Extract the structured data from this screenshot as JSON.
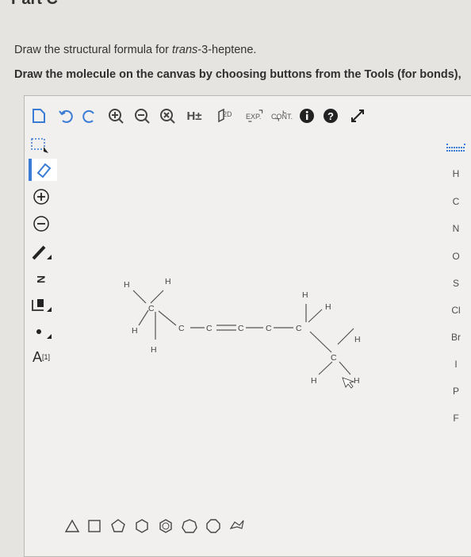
{
  "part_label": "Part C",
  "question": {
    "prefix": "Draw the structural formula for ",
    "compound": "trans",
    "suffix": "-3-heptene.",
    "instruction": "Draw the molecule on the canvas by choosing buttons from the Tools (for bonds),"
  },
  "toolbar": {
    "h_label": "H±",
    "two_d": "2D",
    "exp": "EXP.",
    "cont": "CONT."
  },
  "left_tools": {
    "n_label": "N",
    "atom_label": "A",
    "atom_sup": "[1]"
  },
  "elements": [
    "H",
    "C",
    "N",
    "O",
    "S",
    "Cl",
    "Br",
    "I",
    "P",
    "F"
  ],
  "molecule": {
    "atoms": [
      "H",
      "H",
      "C",
      "H",
      "H",
      "C",
      "C",
      "C",
      "C",
      "H",
      "H",
      "C",
      "H",
      "H",
      "H",
      "C",
      "H",
      "H"
    ],
    "bond_c": "C",
    "bond_h": "H"
  },
  "colors": {
    "accent": "#3a7bd5",
    "toolbar_icon": "#4a4a4a",
    "bond": "#555555"
  }
}
